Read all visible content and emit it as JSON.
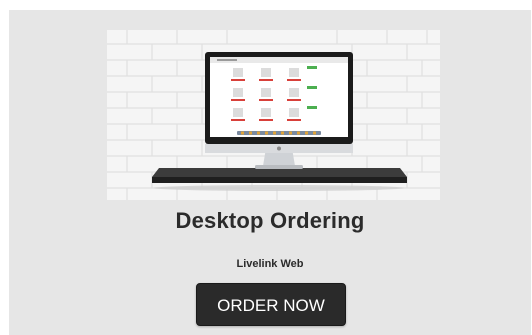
{
  "card": {
    "title": "Desktop Ordering",
    "subtitle": "Livelink Web",
    "button_label": "ORDER NOW"
  },
  "hero": {
    "icon": "desktop-computer-on-shelf-illustration",
    "background": "white-brick-wall"
  },
  "colors": {
    "card_background": "#e6e6e6",
    "button_background": "#2a2a2a",
    "button_text": "#ffffff",
    "title_text": "#2b2b2b"
  }
}
